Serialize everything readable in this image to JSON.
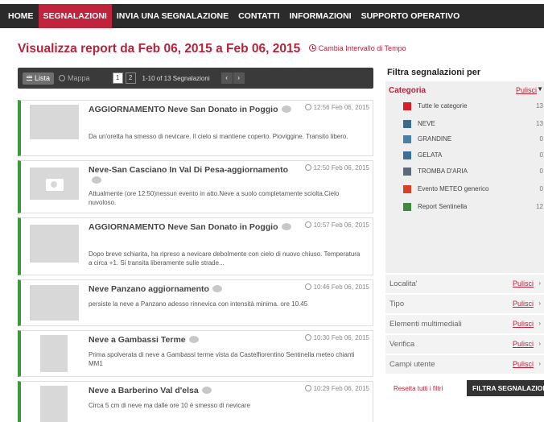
{
  "nav": {
    "items": [
      "HOME",
      "SEGNALAZIONI",
      "INVIA UNA SEGNALAZIONE",
      "CONTATTI",
      "INFORMAZIONI",
      "SUPPORTO OPERATIVO"
    ],
    "active": "SEGNALAZIONI"
  },
  "header": {
    "title": "Visualizza report da Feb 06, 2015 a Feb 06, 2015",
    "change_interval": "Cambia Intervallo di Tempo"
  },
  "toolbar": {
    "list_label": "Lista",
    "map_label": "Mappa",
    "pages": [
      "1",
      "2"
    ],
    "current_page": "1",
    "count_text": "1-10 of 13 Segnalazioni",
    "prev": "‹",
    "next": "›"
  },
  "reports": [
    {
      "title": "AGGIORNAMENTO Neve San Donato in Poggio",
      "time": "12:56 Feb 06, 2015",
      "desc": "Da un'oretta ha smesso di nevicare. Il cielo si mantiene coperto. Pioviggine. Transito libero.",
      "has_photo": true
    },
    {
      "title": "Neve-San Casciano In Val Di Pesa-aggiornamento",
      "time": "12:50 Feb 06, 2015",
      "desc": "Attualmente (ore 12:50)nessun evento in atto.Neve a suolo completamente sciolta.Cielo nuvoloso.",
      "has_photo": false
    },
    {
      "title": "AGGIORNAMENTO Neve San Donato in Poggio",
      "time": "10:57 Feb 06, 2015",
      "desc": "Dopo breve schiarita, ha ripreso a nevicare debolmente con cielo di nuovo chiuso. Temperatura a circa +1. Si transita liberamente sulle strade...",
      "has_photo": true
    },
    {
      "title": "Neve Panzano aggiornamento",
      "time": "10:46 Feb 06, 2015",
      "desc": "persiste la neve a Panzano adesso rinnevica con intensità minima. ore 10.45",
      "has_photo": true
    },
    {
      "title": "Neve a Gambassi Terme",
      "time": "10:30 Feb 06, 2015",
      "desc": "Prima spolverata di neve a Gambassi terme vista da Castelfiorentino Sentinella meteo chianti MM1",
      "has_photo": true
    },
    {
      "title": "Neve a Barberino Val d'elsa",
      "time": "10:29 Feb 06, 2015",
      "desc": "Circa 5 cm di neve ma dalle ore 10 è smesso di nevicare",
      "has_photo": true
    }
  ],
  "filters": {
    "title": "Filtra segnalazioni per",
    "category_head": "Categoria",
    "clear": "Pulisci",
    "categories": [
      {
        "label": "Tutte le categorie",
        "count": "13",
        "color": "#d61f26"
      },
      {
        "label": "NEVE",
        "count": "13",
        "color": "#3b6b8c"
      },
      {
        "label": "GRANDINE",
        "count": "0",
        "color": "#4a7fa6"
      },
      {
        "label": "GELATA",
        "count": "0",
        "color": "#3c6f9c"
      },
      {
        "label": "TROMBA D'ARIA",
        "count": "0",
        "color": "#5a6a7a"
      },
      {
        "label": "Evento METEO generico",
        "count": "0",
        "color": "#d8402a"
      },
      {
        "label": "Report Sentinella",
        "count": "12",
        "color": "#3e8a3e"
      }
    ],
    "sections": [
      "Localita'",
      "Tipo",
      "Elementi multimediali",
      "Verifica",
      "Campi utente"
    ],
    "reset_all": "Resetta tutti i filtri",
    "apply": "FILTRA SEGNALAZIONI"
  }
}
